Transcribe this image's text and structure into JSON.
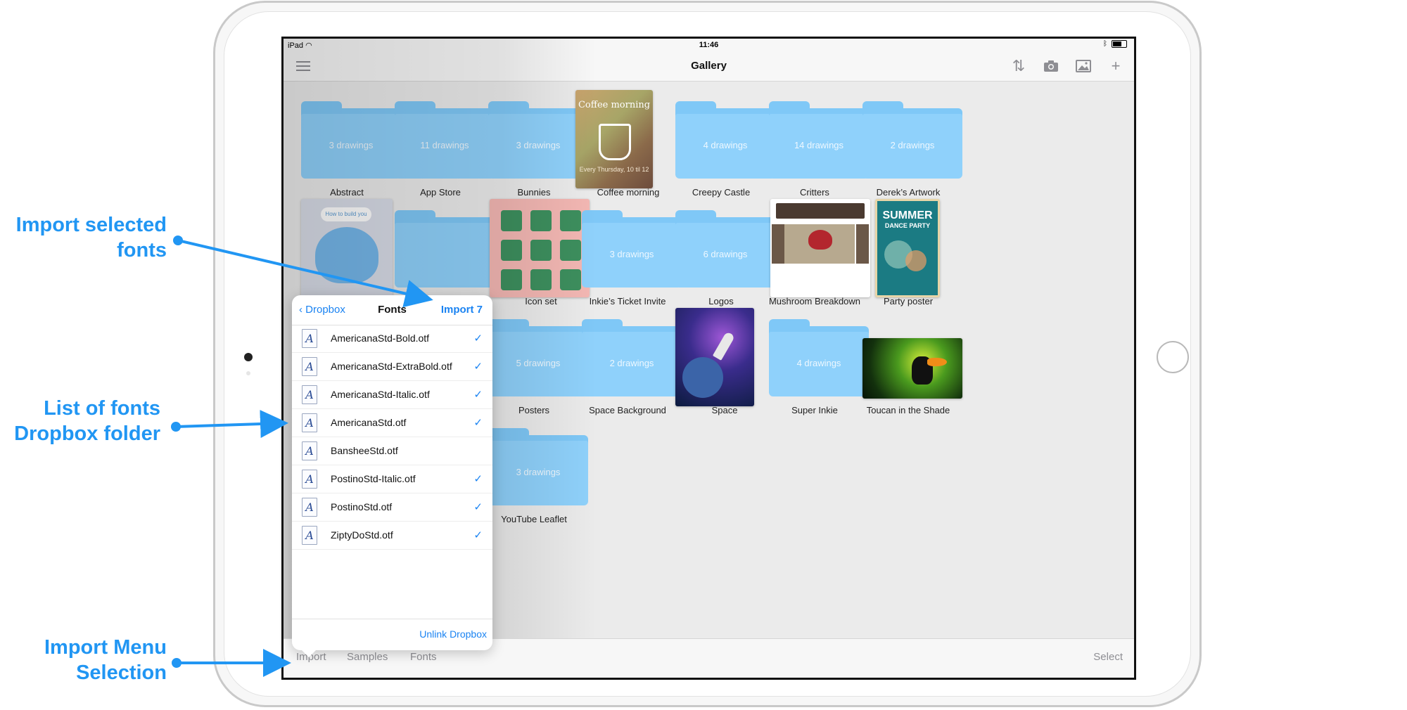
{
  "status": {
    "carrier": "iPad",
    "time": "11:46"
  },
  "nav": {
    "title": "Gallery",
    "icons": [
      "menu-icon",
      "sort-icon",
      "camera-icon",
      "image-icon",
      "plus-icon"
    ]
  },
  "gallery": {
    "items": [
      {
        "label": "Abstract",
        "type": "folder",
        "count": "3 drawings"
      },
      {
        "label": "App Store",
        "type": "folder",
        "count": "11 drawings"
      },
      {
        "label": "Bunnies",
        "type": "folder",
        "count": "3 drawings"
      },
      {
        "label": "Coffee morning",
        "type": "thumbnail",
        "thumb_title": "Coffee morning",
        "thumb_sub": "Every Thursday, 10 til 12"
      },
      {
        "label": "Creepy Castle",
        "type": "folder",
        "count": "4 drawings"
      },
      {
        "label": "Critters",
        "type": "folder",
        "count": "14 drawings"
      },
      {
        "label": "Derek’s Artwork",
        "type": "folder",
        "count": "2 drawings"
      },
      {
        "label": "Icon set",
        "type": "thumbnail"
      },
      {
        "label": "Inkie’s Ticket Invite",
        "type": "folder",
        "count": "3 drawings"
      },
      {
        "label": "Logos",
        "type": "folder",
        "count": "6 drawings"
      },
      {
        "label": "Mushroom Breakdown",
        "type": "thumbnail"
      },
      {
        "label": "Party poster",
        "type": "thumbnail",
        "thumb_title": "SUMMER",
        "thumb_sub": "DANCE PARTY"
      },
      {
        "label": "Posters",
        "type": "folder",
        "count": "5 drawings"
      },
      {
        "label": "Space Background",
        "type": "folder",
        "count": "2 drawings"
      },
      {
        "label": "Space",
        "type": "thumbnail"
      },
      {
        "label": "Super Inkie",
        "type": "folder",
        "count": "4 drawings"
      },
      {
        "label": "Toucan in the Shade",
        "type": "thumbnail"
      },
      {
        "label": "YouTube Leaflet",
        "type": "folder",
        "count": "3 drawings"
      }
    ],
    "robot_bubble": "How to build you"
  },
  "popover": {
    "back_label": "Dropbox",
    "title": "Fonts",
    "import_label": "Import 7",
    "fonts": [
      {
        "name": "AmericanaStd-Bold.otf",
        "checked": true
      },
      {
        "name": "AmericanaStd-ExtraBold.otf",
        "checked": true
      },
      {
        "name": "AmericanaStd-Italic.otf",
        "checked": true
      },
      {
        "name": "AmericanaStd.otf",
        "checked": true
      },
      {
        "name": "BansheeStd.otf",
        "checked": false
      },
      {
        "name": "PostinoStd-Italic.otf",
        "checked": true
      },
      {
        "name": "PostinoStd.otf",
        "checked": true
      },
      {
        "name": "ZiptyDoStd.otf",
        "checked": true
      }
    ],
    "font_icon_glyph": "A",
    "check_glyph": "✓",
    "unlink_label": "Unlink Dropbox"
  },
  "toolbar": {
    "import_label": "Import",
    "samples_label": "Samples",
    "fonts_label": "Fonts",
    "select_label": "Select"
  },
  "annotations": {
    "import_selected": [
      "Import selected",
      "fonts"
    ],
    "list_of_fonts": [
      "List of fonts",
      "Dropbox folder"
    ],
    "import_menu": [
      "Import Menu",
      "Selection"
    ]
  },
  "colors": {
    "accent": "#1a83f2",
    "annotation": "#2196f3",
    "folder": "#8fd1fb"
  }
}
